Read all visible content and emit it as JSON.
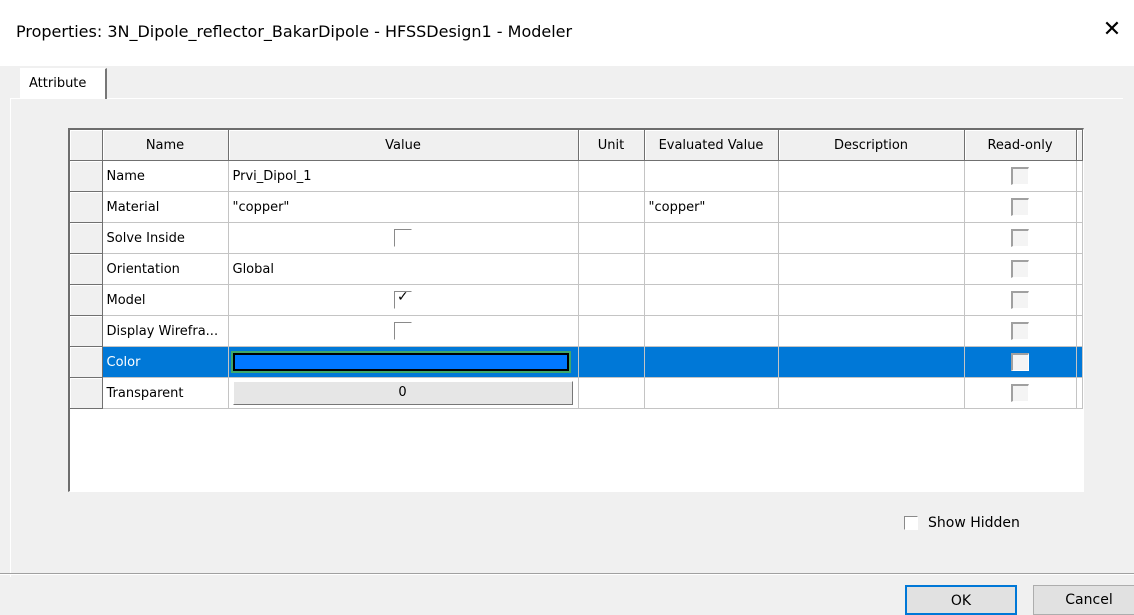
{
  "window": {
    "title": "Properties: 3N_Dipole_reflector_BakarDipole - HFSSDesign1 - Modeler",
    "close_glyph": "✕"
  },
  "tabs": [
    {
      "label": "Attribute",
      "active": true
    }
  ],
  "grid": {
    "columns": [
      "Name",
      "Value",
      "Unit",
      "Evaluated Value",
      "Description",
      "Read-only"
    ],
    "rows": [
      {
        "name": "Name",
        "value": "Prvi_Dipol_1",
        "unit": "",
        "evaluated": "",
        "description": ""
      },
      {
        "name": "Material",
        "value": "\"copper\"",
        "unit": "",
        "evaluated": "\"copper\"",
        "description": ""
      },
      {
        "name": "Solve Inside",
        "value": "",
        "checked": false
      },
      {
        "name": "Orientation",
        "value": "Global",
        "unit": "",
        "evaluated": "",
        "description": ""
      },
      {
        "name": "Model",
        "value": "",
        "checked": true
      },
      {
        "name": "Display Wirefra...",
        "value": "",
        "checked": false
      },
      {
        "name": "Color",
        "color": "#0078ff",
        "selected": true
      },
      {
        "name": "Transparent",
        "value": "0"
      }
    ],
    "selection_color": "#0078d7",
    "checkmark": "✓"
  },
  "show_hidden": {
    "label": "Show Hidden",
    "checked": false
  },
  "buttons": {
    "ok": "OK",
    "cancel": "Cancel"
  }
}
